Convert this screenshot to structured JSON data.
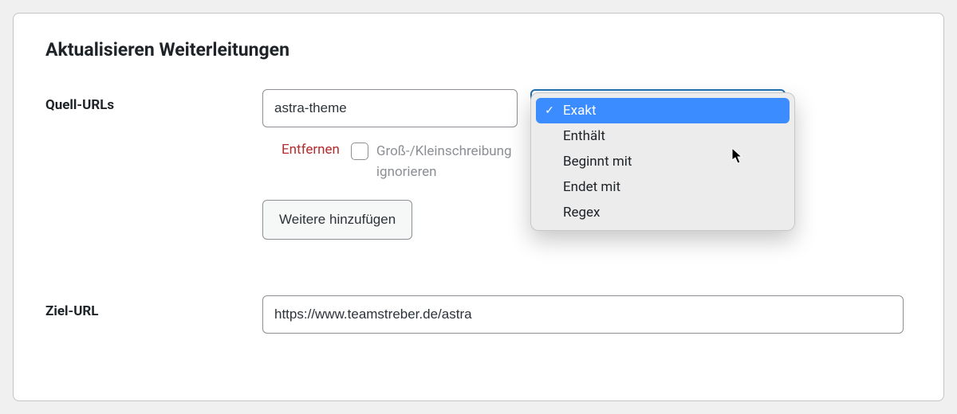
{
  "page": {
    "title": "Aktualisieren Weiterleitungen"
  },
  "labels": {
    "source_urls": "Quell-URLs",
    "target_url": "Ziel-URL"
  },
  "source": {
    "value": "astra-theme",
    "remove": "Entfernen",
    "ignore_case": "Groß-/Kleinschreibung ignorieren",
    "add_more": "Weitere hinzufügen",
    "match_type_selected": "Exakt",
    "match_options": {
      "exact": "Exakt",
      "contains": "Enthält",
      "starts_with": "Beginnt mit",
      "ends_with": "Endet mit",
      "regex": "Regex"
    }
  },
  "target": {
    "value": "https://www.teamstreber.de/astra"
  }
}
